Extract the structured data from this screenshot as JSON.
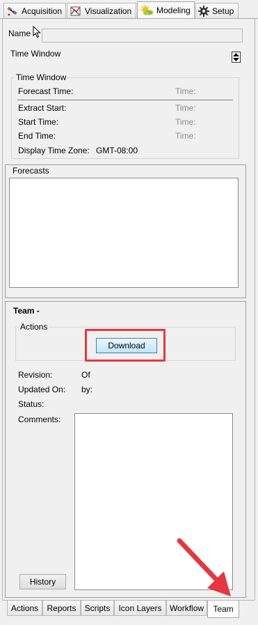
{
  "top_tabs": [
    {
      "label": "Acquisition",
      "icon": "satellite-icon"
    },
    {
      "label": "Visualization",
      "icon": "chart-icon"
    },
    {
      "label": "Modeling",
      "icon": "sun-cloud-icon",
      "active": true
    },
    {
      "label": "Setup",
      "icon": "gear-icon"
    }
  ],
  "name_label": "Name",
  "name_value": "",
  "time_window_label": "Time Window",
  "time_window_group": {
    "legend": "Time Window",
    "forecast_time": "Forecast Time:",
    "extract_start": "Extract Start:",
    "start_time": "Start Time:",
    "end_time": "End Time:",
    "time_placeholder": "Time:",
    "display_time_zone_label": "Display Time Zone:",
    "display_time_zone_value": "GMT-08:00"
  },
  "forecasts": {
    "legend": "Forecasts"
  },
  "team": {
    "title": "Team -",
    "actions_legend": "Actions",
    "download_label": "Download",
    "revision_label": "Revision:",
    "revision_value": "Of",
    "updated_label": "Updated On:",
    "updated_by": "by:",
    "status_label": "Status:",
    "comments_label": "Comments:",
    "history_label": "History"
  },
  "bottom_tabs": [
    {
      "label": "Actions"
    },
    {
      "label": "Reports"
    },
    {
      "label": "Scripts"
    },
    {
      "label": "Icon Layers"
    },
    {
      "label": "Workflow"
    },
    {
      "label": "Team",
      "active": true
    }
  ],
  "colors": {
    "highlight": "#e4373e",
    "arrow": "#e4373e"
  }
}
